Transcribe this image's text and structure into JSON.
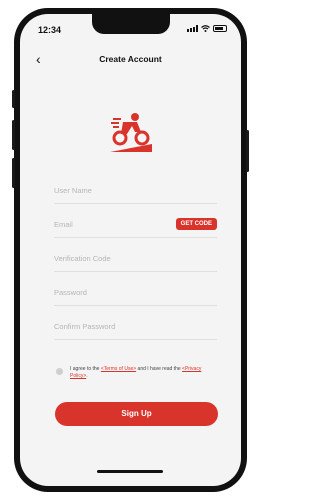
{
  "status_bar": {
    "time": "12:34"
  },
  "header": {
    "back_icon": "chevron-left-icon",
    "title": "Create Account"
  },
  "form": {
    "user_name_placeholder": "User Name",
    "email_placeholder": "Email",
    "get_code_label": "GET CODE",
    "verification_placeholder": "Verification Code",
    "password_placeholder": "Password",
    "confirm_password_placeholder": "Confirm Password"
  },
  "agreement": {
    "prefix": "I agree to the ",
    "terms_link": "<Terms of Use>",
    "middle": " and I have read the ",
    "privacy_link": "<Privacy Policy>",
    "suffix": "."
  },
  "signup_label": "Sign Up",
  "colors": {
    "accent": "#d9342b",
    "background": "#f4f4f4"
  }
}
